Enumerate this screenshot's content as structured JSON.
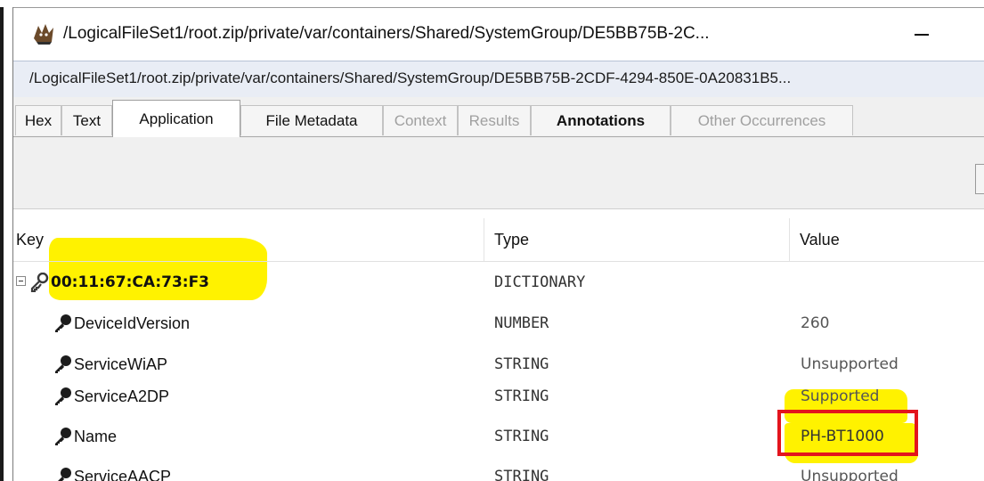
{
  "window": {
    "title": "/LogicalFileSet1/root.zip/private/var/containers/Shared/SystemGroup/DE5BB75B-2C...",
    "path": "/LogicalFileSet1/root.zip/private/var/containers/Shared/SystemGroup/DE5BB75B-2CDF-4294-850E-0A20831B5..."
  },
  "tabs": [
    {
      "label": "Hex",
      "state": "normal"
    },
    {
      "label": "Text",
      "state": "normal"
    },
    {
      "label": "Application",
      "state": "active"
    },
    {
      "label": "File Metadata",
      "state": "normal"
    },
    {
      "label": "Context",
      "state": "disabled"
    },
    {
      "label": "Results",
      "state": "disabled"
    },
    {
      "label": "Annotations",
      "state": "bold"
    },
    {
      "label": "Other Occurrences",
      "state": "disabled"
    }
  ],
  "table": {
    "headers": {
      "key": "Key",
      "type": "Type",
      "value": "Value"
    },
    "rows": [
      {
        "key": "00:11:67:CA:73:F3",
        "type": "DICTIONARY",
        "value": ""
      },
      {
        "key": "DeviceIdVersion",
        "type": "NUMBER",
        "value": "260"
      },
      {
        "key": "ServiceWiAP",
        "type": "STRING",
        "value": "Unsupported"
      },
      {
        "key": "ServiceA2DP",
        "type": "STRING",
        "value": "Supported"
      },
      {
        "key": "Name",
        "type": "STRING",
        "value": "PH-BT1000"
      },
      {
        "key": "ServiceAACP",
        "type": "STRING",
        "value": "Unsupported"
      }
    ]
  },
  "colors": {
    "highlight": "#fff200",
    "annotation_box": "#e3141d",
    "path_bar_bg": "#e9edf5"
  }
}
